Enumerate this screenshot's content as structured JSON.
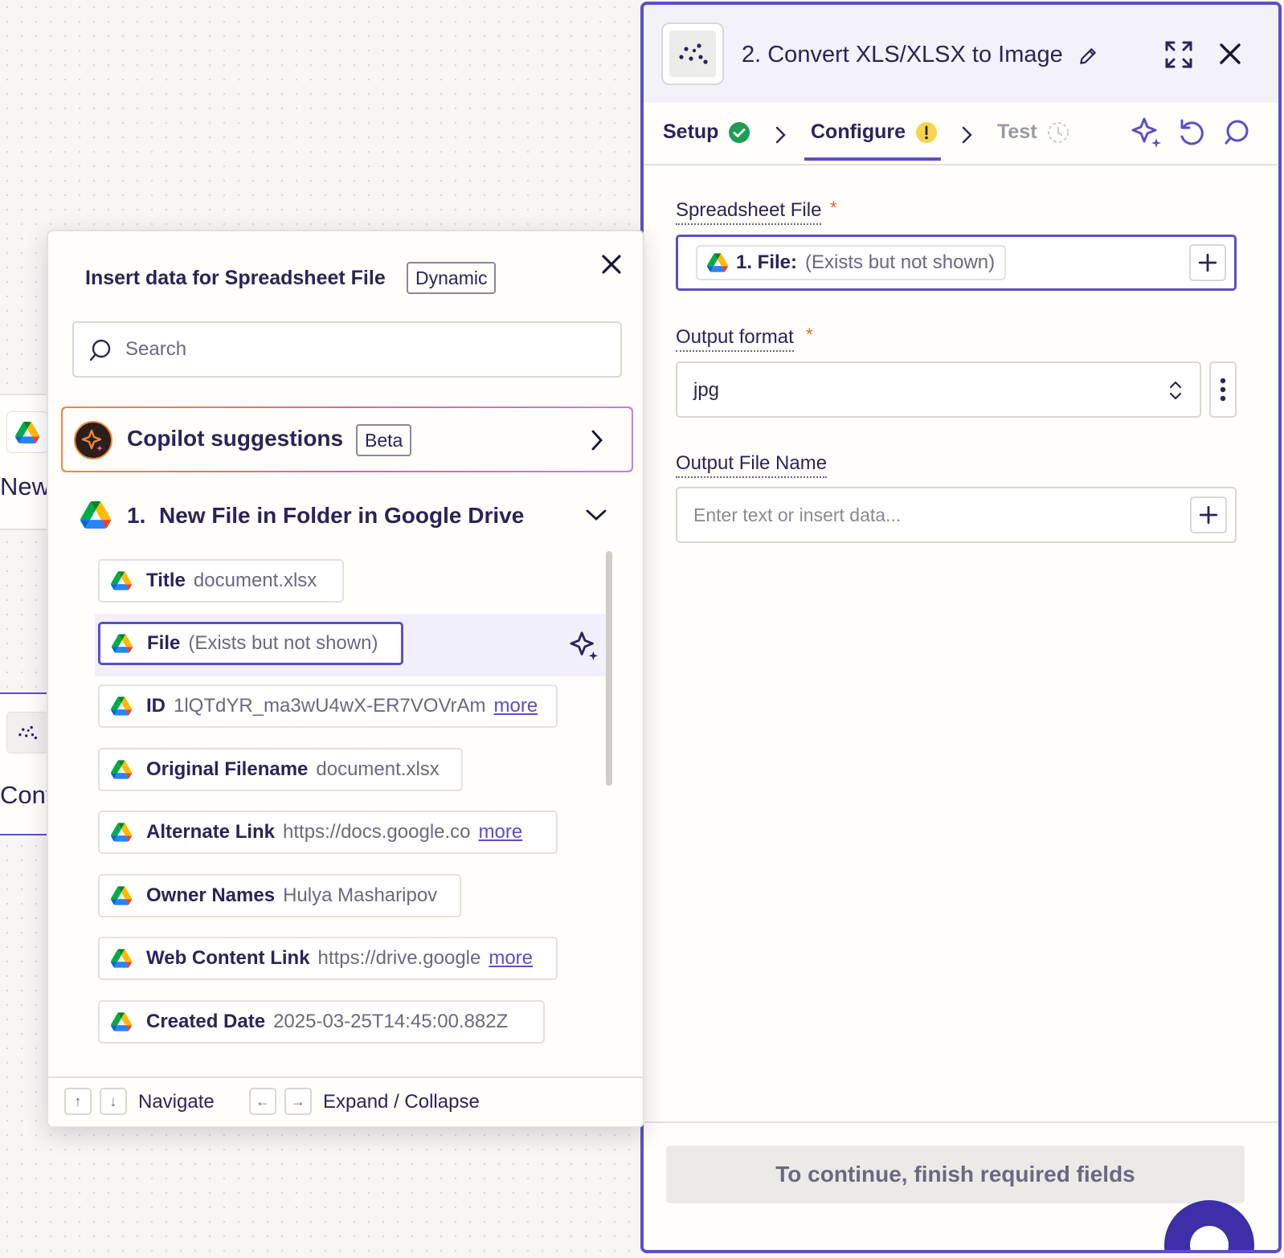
{
  "canvas": {
    "step1_label": "New",
    "step2_label": "Conv"
  },
  "panel": {
    "title": "2. Convert XLS/XLSX to Image",
    "tabs": {
      "setup": "Setup",
      "configure": "Configure",
      "test": "Test"
    },
    "fields": {
      "spreadsheet_file": {
        "label": "Spreadsheet File",
        "required": "*",
        "pill_key": "1. File:",
        "pill_value": "(Exists but not shown)"
      },
      "output_format": {
        "label": "Output format",
        "required": "*",
        "value": "jpg"
      },
      "output_file_name": {
        "label": "Output File Name",
        "placeholder": "Enter text or insert data..."
      }
    },
    "continue_label": "To continue, finish required fields"
  },
  "popup": {
    "title": "Insert data for Spreadsheet File",
    "badge": "Dynamic",
    "search_placeholder": "Search",
    "copilot": {
      "label": "Copilot suggestions",
      "badge": "Beta"
    },
    "group": {
      "number": "1.",
      "title": "New File in Folder in Google Drive"
    },
    "items": [
      {
        "key": "Title",
        "value": "document.xlsx",
        "more": ""
      },
      {
        "key": "File",
        "value": "(Exists but not shown)",
        "more": ""
      },
      {
        "key": "ID",
        "value": "1lQTdYR_ma3wU4wX-ER7VOVrAm",
        "more": "more"
      },
      {
        "key": "Original Filename",
        "value": "document.xlsx",
        "more": ""
      },
      {
        "key": "Alternate Link",
        "value": "https://docs.google.co",
        "more": "more"
      },
      {
        "key": "Owner Names",
        "value": "Hulya Masharipov",
        "more": ""
      },
      {
        "key": "Web Content Link",
        "value": "https://drive.google",
        "more": "more"
      },
      {
        "key": "Created Date",
        "value": "2025-03-25T14:45:00.882Z",
        "more": ""
      }
    ],
    "footer": {
      "up_key": "↑",
      "down_key": "↓",
      "navigate": "Navigate",
      "left_key": "←",
      "right_key": "→",
      "expand_collapse": "Expand / Collapse"
    }
  },
  "colors": {
    "accent": "#5a4ec9",
    "text": "#2b2358",
    "success": "#1f9d55",
    "warning": "#f5d547",
    "required": "#e8622c"
  }
}
